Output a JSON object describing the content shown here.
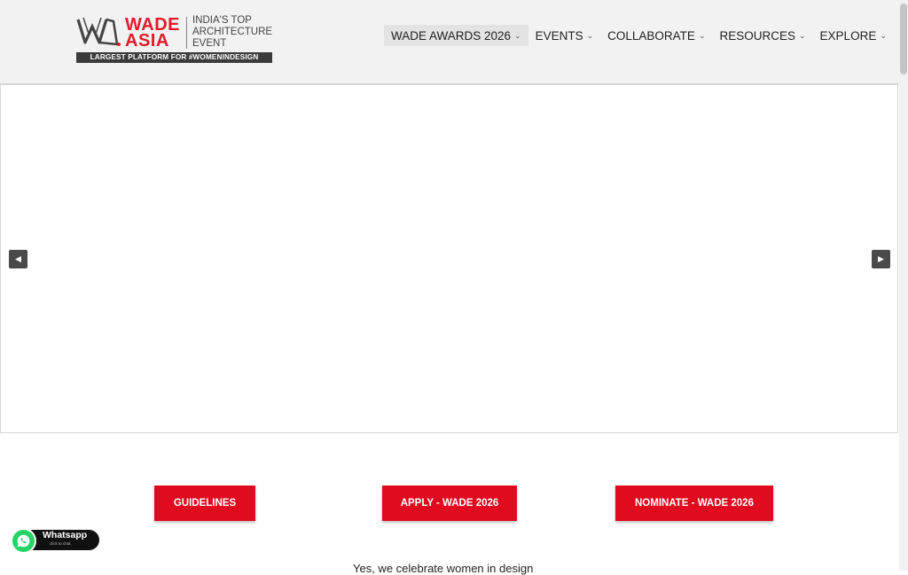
{
  "header": {
    "logo": {
      "wade": "WADE",
      "asia": "ASIA",
      "tagline_lines": [
        "INDIA'S TOP",
        "ARCHITECTURE",
        "EVENT"
      ],
      "bar_text": "LARGEST PLATFORM FOR #WOMENINDESIGN",
      "brand_color": "#e21b2b"
    },
    "nav": [
      {
        "label": "WADE AWARDS 2026",
        "active": true
      },
      {
        "label": "EVENTS"
      },
      {
        "label": "COLLABORATE"
      },
      {
        "label": "RESOURCES"
      },
      {
        "label": "EXPLORE"
      }
    ],
    "chevron_icon": "chevron-down-icon"
  },
  "slider": {
    "prev_icon": "arrow-left-icon",
    "next_icon": "arrow-right-icon"
  },
  "cta": {
    "guidelines": "GUIDELINES",
    "apply": "APPLY - WADE 2026",
    "nominate": "NOMINATE - WADE 2026",
    "color": "#e00b1f"
  },
  "tagline": "Yes, we celebrate women in design",
  "whatsapp": {
    "label": "Whatsapp",
    "sub": "click to chat",
    "color": "#25d366"
  }
}
